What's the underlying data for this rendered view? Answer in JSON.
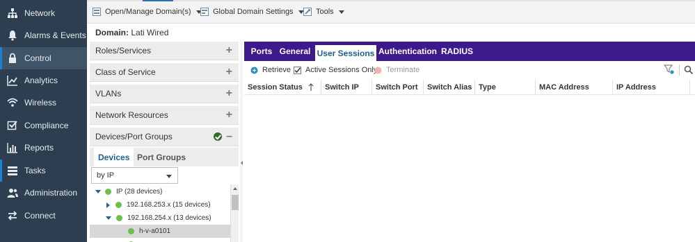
{
  "nav": {
    "items": [
      {
        "label": "Network",
        "icon": "network-icon"
      },
      {
        "label": "Alarms & Events",
        "icon": "bell-icon"
      },
      {
        "label": "Control",
        "icon": "lock-icon"
      },
      {
        "label": "Analytics",
        "icon": "analytics-icon"
      },
      {
        "label": "Wireless",
        "icon": "wifi-icon"
      },
      {
        "label": "Compliance",
        "icon": "checkbox-icon"
      },
      {
        "label": "Reports",
        "icon": "bar-chart-icon"
      },
      {
        "label": "Tasks",
        "icon": "tasks-icon"
      },
      {
        "label": "Administration",
        "icon": "users-icon"
      },
      {
        "label": "Connect",
        "icon": "connect-icon"
      }
    ],
    "active": "Control",
    "accent_color": "#1a83d8",
    "background_color": "#2c3e50"
  },
  "toolbar": {
    "open_manage_label": "Open/Manage Domain(s)",
    "global_settings_label": "Global Domain Settings",
    "tools_label": "Tools"
  },
  "domain": {
    "label": "Domain:",
    "value": "Lati Wired"
  },
  "sidebar": {
    "sections": [
      {
        "label": "Roles/Services"
      },
      {
        "label": "Class of Service"
      },
      {
        "label": "VLANs"
      },
      {
        "label": "Network Resources"
      },
      {
        "label": "Devices/Port Groups"
      }
    ],
    "subtabs": {
      "devices_label": "Devices",
      "port_groups_label": "Port Groups"
    },
    "select_value": "by IP",
    "tree": {
      "root": "IP (28 devices)",
      "child1": "192.168.253.x (15 devices)",
      "child2": "192.168.254.x (13 devices)",
      "leaf": "h-v-a0101"
    }
  },
  "main": {
    "tabs": {
      "ports": "Ports",
      "general": "General",
      "user_sessions": "User Sessions",
      "authentication": "Authentication",
      "radius": "RADIUS"
    },
    "active_tab": "User Sessions",
    "tabbar_color": "#3c1a8c",
    "actions": {
      "retrieve": "Retrieve",
      "active_only": "Active Sessions Only",
      "terminate": "Terminate"
    },
    "columns": {
      "session_status": "Session Status",
      "switch_ip": "Switch IP",
      "switch_port": "Switch Port",
      "switch_alias": "Switch Alias",
      "type": "Type",
      "mac_address": "MAC Address",
      "ip_address": "IP Address"
    }
  }
}
